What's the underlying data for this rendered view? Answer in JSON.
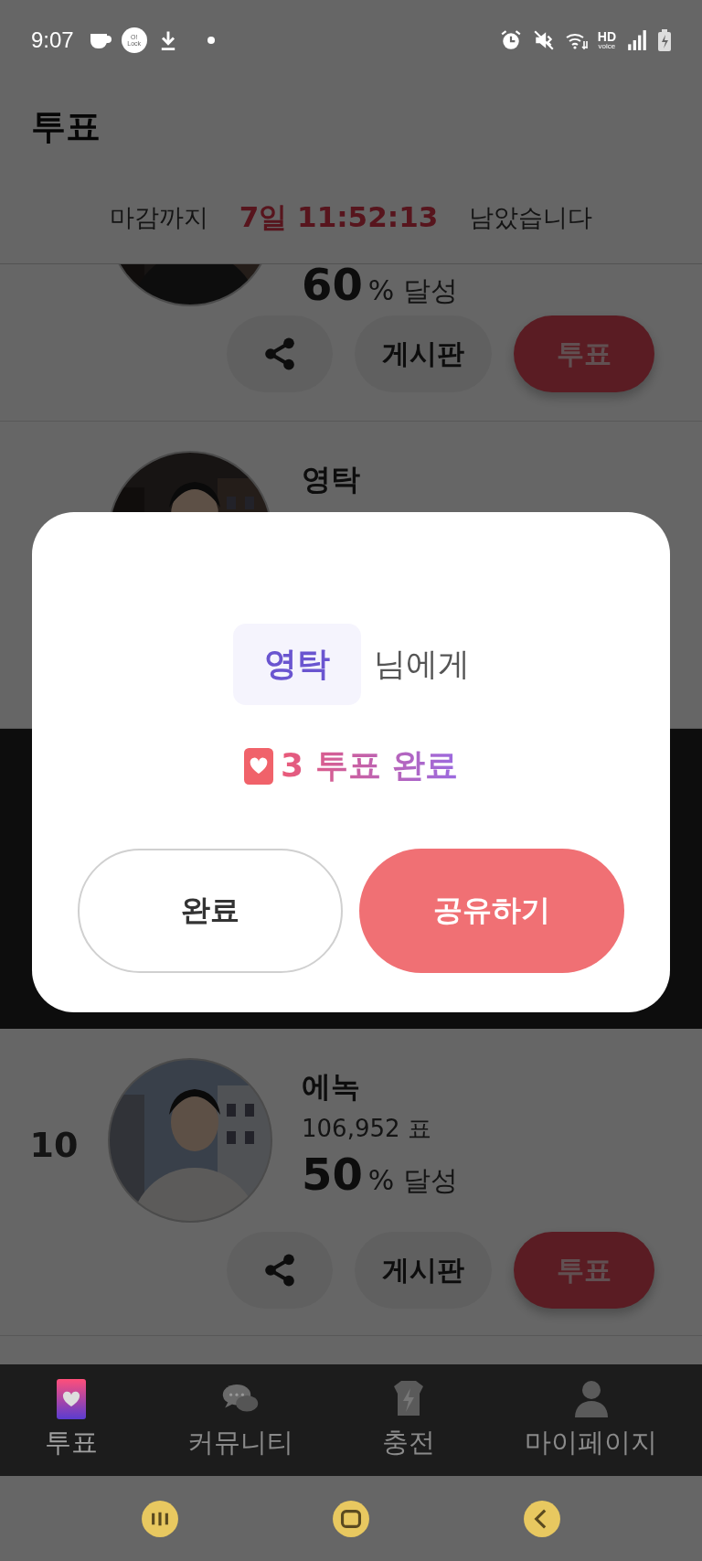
{
  "status_bar": {
    "time": "9:07",
    "lock_badge": [
      "O!",
      "Lock"
    ],
    "voice_badge": [
      "HD",
      "voice"
    ]
  },
  "header": {
    "title": "투표"
  },
  "countdown": {
    "prefix": "마감까지",
    "remaining": "7일 11:52:13",
    "suffix": "남았습니다"
  },
  "candidates": [
    {
      "percent": "60",
      "percent_label": "% 달성",
      "board_button": "게시판",
      "vote_button": "투표"
    },
    {
      "name": "영탁"
    },
    {
      "rank": "10",
      "name": "에녹",
      "votes": "106,952 표",
      "percent": "50",
      "percent_label": "% 달성",
      "board_button": "게시판",
      "vote_button": "투표"
    }
  ],
  "dialog": {
    "recipient": "영탁",
    "recipient_suffix": "님에게",
    "result": "3 투표 완료",
    "buttons": [
      {
        "label": "완료",
        "kind": "secondary"
      },
      {
        "label": "공유하기",
        "kind": "primary"
      }
    ]
  },
  "bottom_nav": [
    {
      "label": "투표",
      "selected": true
    },
    {
      "label": "커뮤니티",
      "selected": false
    },
    {
      "label": "충전",
      "selected": false
    },
    {
      "label": "마이페이지",
      "selected": false
    }
  ]
}
